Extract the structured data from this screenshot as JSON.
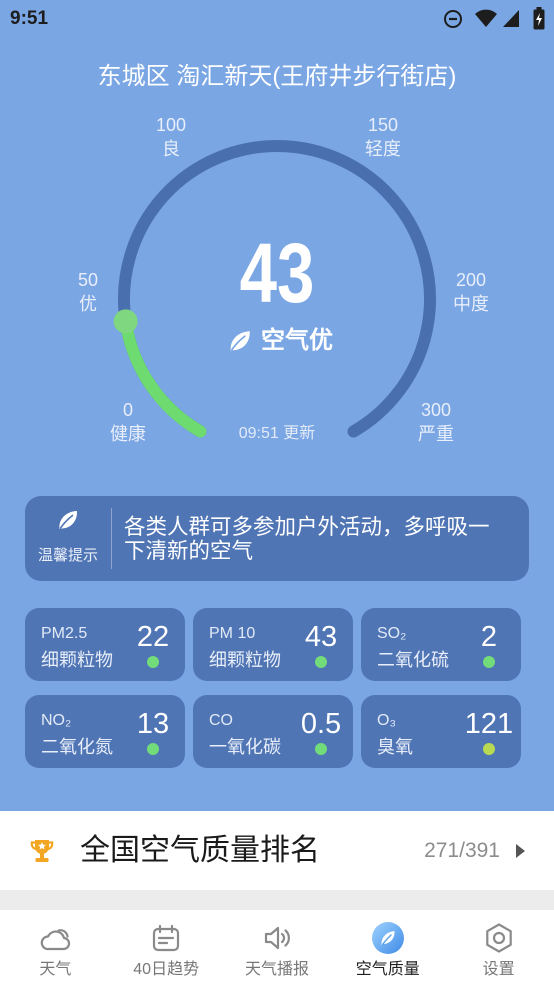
{
  "status_bar": {
    "time": "9:51",
    "icons": [
      "do-not-disturb-icon",
      "wifi-icon",
      "cellular-signal-icon",
      "battery-charging-icon"
    ]
  },
  "location": "东城区 淘汇新天(王府井步行街店)",
  "gauge": {
    "aqi": 43,
    "level": "空气优",
    "level_icon": "leaf-icon",
    "updated": "09:51 更新",
    "scale": [
      {
        "value": 0,
        "label": "健康"
      },
      {
        "value": 50,
        "label": "优"
      },
      {
        "value": 100,
        "label": "良"
      },
      {
        "value": 150,
        "label": "轻度"
      },
      {
        "value": 200,
        "label": "中度"
      },
      {
        "value": 300,
        "label": "严重"
      }
    ]
  },
  "tip": {
    "icon": "leaf-icon",
    "label": "温馨提示",
    "text": "各类人群可多参加户外活动，多呼吸一下清新的空气"
  },
  "pollutants": [
    {
      "code": "PM2.5",
      "name": "细颗粒物",
      "value": "22",
      "dot_color": "#72dc7a"
    },
    {
      "code": "PM 10",
      "name": "细颗粒物",
      "value": "43",
      "dot_color": "#72dc7a"
    },
    {
      "code": "SO₂",
      "name": "二氧化硫",
      "value": "2",
      "dot_color": "#72dc7a"
    },
    {
      "code": "NO₂",
      "name": "二氧化氮",
      "value": "13",
      "dot_color": "#72dc7a"
    },
    {
      "code": "CO",
      "name": "一氧化碳",
      "value": "0.5",
      "dot_color": "#72dc7a"
    },
    {
      "code": "O₃",
      "name": "臭氧",
      "value": "121",
      "dot_color": "#b8d952"
    }
  ],
  "ranking": {
    "icon": "trophy-icon",
    "title": "全国空气质量排名",
    "value": "271/391"
  },
  "nav": {
    "items": [
      {
        "label": "天气",
        "icon": "weather-cloud-icon",
        "active": false
      },
      {
        "label": "40日趋势",
        "icon": "calendar-icon",
        "active": false
      },
      {
        "label": "天气播报",
        "icon": "broadcast-speaker-icon",
        "active": false
      },
      {
        "label": "空气质量",
        "icon": "air-quality-icon",
        "active": true
      },
      {
        "label": "设置",
        "icon": "settings-icon",
        "active": false
      }
    ]
  },
  "colors": {
    "background": "#7aa6e4",
    "card": "#5075b5",
    "gauge_track": "#4a6fae",
    "gauge_progress": "#6edb71",
    "gauge_indicator": "#7fd77f",
    "accent": "#4a96ee",
    "trophy": "#f2a623"
  }
}
